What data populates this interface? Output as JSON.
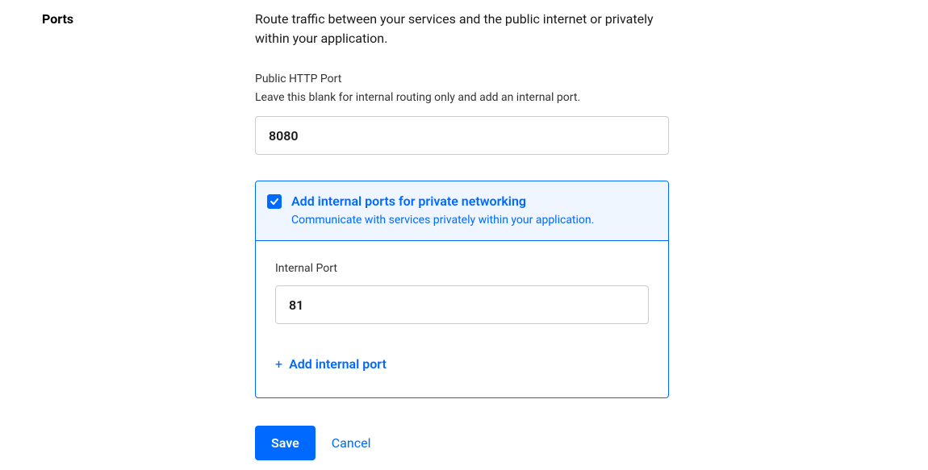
{
  "section": {
    "title": "Ports",
    "description": "Route traffic between your services and the public internet or privately within your application."
  },
  "public_port": {
    "label": "Public HTTP Port",
    "help": "Leave this blank for internal routing only and add an internal port.",
    "value": "8080"
  },
  "internal": {
    "checkbox_checked": true,
    "title": "Add internal ports for private networking",
    "subtitle": "Communicate with services privately within your application.",
    "port_label": "Internal Port",
    "port_value": "81",
    "add_button": "Add internal port"
  },
  "actions": {
    "save": "Save",
    "cancel": "Cancel"
  }
}
